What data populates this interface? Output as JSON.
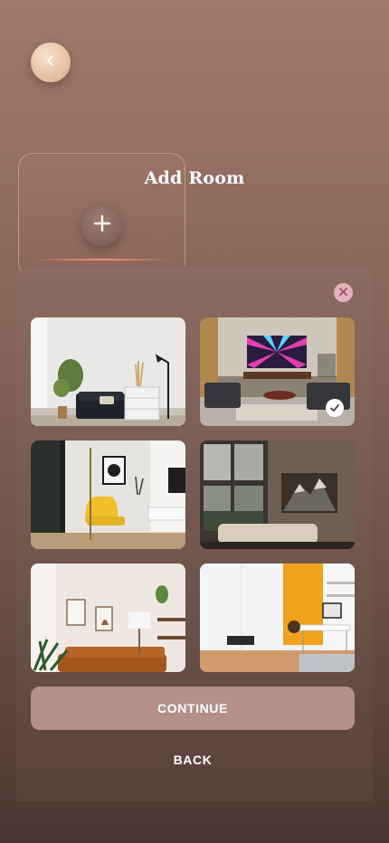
{
  "header": {
    "back_icon": "chevron-left-icon"
  },
  "add_room": {
    "title": "Add Room",
    "add_icon": "plus-icon"
  },
  "sheet": {
    "close_icon": "close-icon",
    "rooms": [
      {
        "name": "living-room-white",
        "selected": false
      },
      {
        "name": "living-room-tv",
        "selected": true
      },
      {
        "name": "living-room-yellow-chair",
        "selected": false
      },
      {
        "name": "living-room-large-windows",
        "selected": false
      },
      {
        "name": "living-room-orange-sofa",
        "selected": false
      },
      {
        "name": "office-orange-wall",
        "selected": false
      }
    ],
    "check_icon": "check-icon"
  },
  "actions": {
    "continue_label": "CONTINUE",
    "back_label": "BACK"
  },
  "colors": {
    "accent": "#b49087",
    "close": "#e4b2bd",
    "back_button": "#e9c3a6"
  }
}
